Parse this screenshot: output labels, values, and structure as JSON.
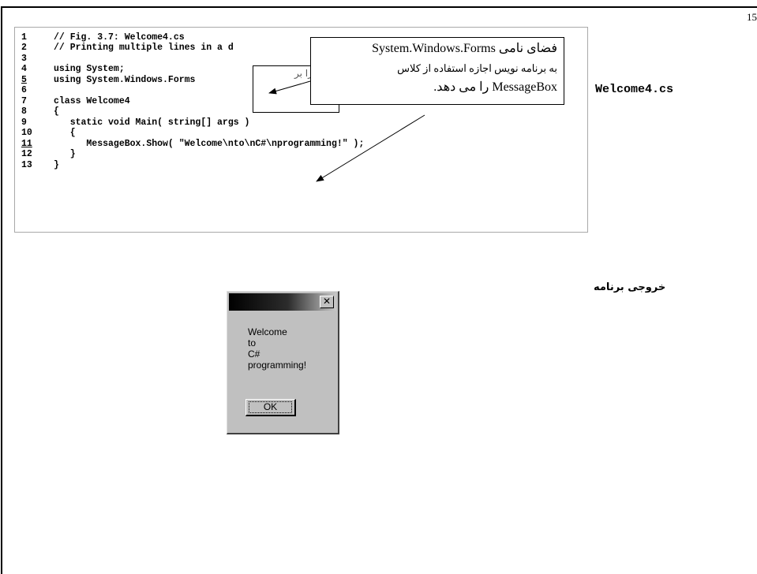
{
  "page_number": "15",
  "file_label": "Welcome4.cs",
  "code_lines": [
    {
      "num": "1",
      "text": "// Fig. 3.7: Welcome4.cs"
    },
    {
      "num": "2",
      "text": "// Printing multiple lines in a d"
    },
    {
      "num": "3",
      "text": ""
    },
    {
      "num": "4",
      "text": "using System;"
    },
    {
      "num": "5",
      "text": "using System.Windows.Forms"
    },
    {
      "num": "6",
      "text": ""
    },
    {
      "num": "7",
      "text": "class Welcome4"
    },
    {
      "num": "8",
      "text": "{"
    },
    {
      "num": "9",
      "text": "   static void Main( string[] args )"
    },
    {
      "num": "10",
      "text": "   {"
    },
    {
      "num": "11",
      "text": "      MessageBox.Show( \"Welcome\\nto\\nC#\\nprogramming!\" );"
    },
    {
      "num": "12",
      "text": "   }"
    },
    {
      "num": "13",
      "text": "}"
    }
  ],
  "callout_back_text": "را بر",
  "callout": {
    "line1": "فضای نامی System.Windows.Forms",
    "line2": "به برنامه نویس اجازه استفاده از کلاس",
    "line3": "MessageBox را می دهد."
  },
  "output_label": "خروجی برنامه",
  "message_box": {
    "close_glyph": "✕",
    "lines": [
      "Welcome",
      "to",
      "C#",
      "programming!"
    ],
    "ok_label": "OK"
  }
}
